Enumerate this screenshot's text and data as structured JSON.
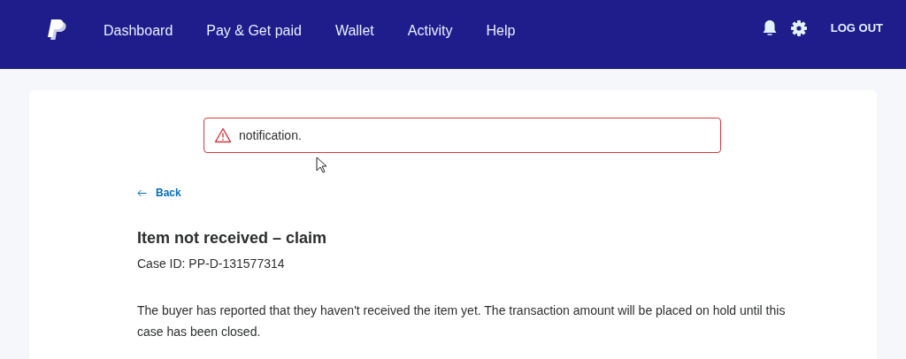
{
  "nav": {
    "items": [
      {
        "label": "Dashboard",
        "selected": false
      },
      {
        "label": "Pay & Get paid",
        "selected": false
      },
      {
        "label": "Wallet",
        "selected": false
      },
      {
        "label": "Activity",
        "selected": false
      },
      {
        "label": "Help",
        "selected": false
      }
    ],
    "logout": "LOG OUT"
  },
  "alert": {
    "kind": "warning",
    "message": "notification."
  },
  "back_link": "Back",
  "case": {
    "title": "Item not received – claim",
    "case_id": "Case ID: PP-D-131577314",
    "description": "The buyer has reported that they haven't received the item yet. The transaction amount will be placed on hold until this case has been closed."
  }
}
